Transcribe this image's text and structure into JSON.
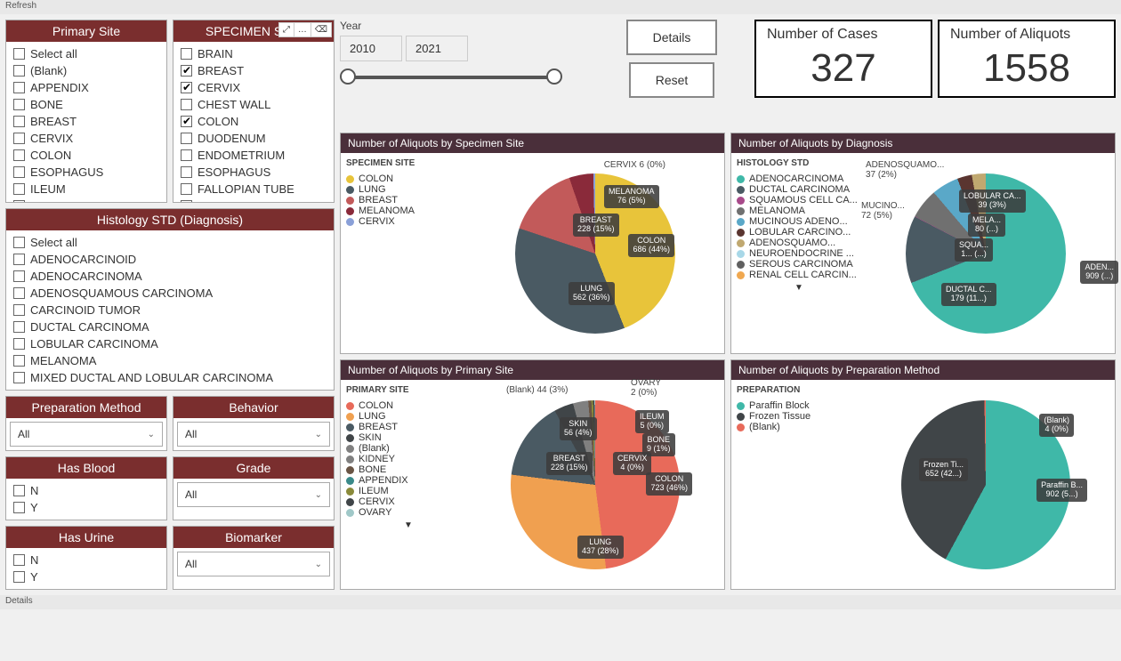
{
  "topbar": {
    "refresh": "Refresh"
  },
  "bottombar": {
    "details": "Details"
  },
  "filters": {
    "primary_site": {
      "title": "Primary Site",
      "items": [
        {
          "label": "Select all",
          "checked": false
        },
        {
          "label": "(Blank)",
          "checked": false
        },
        {
          "label": "APPENDIX",
          "checked": false
        },
        {
          "label": "BONE",
          "checked": false
        },
        {
          "label": "BREAST",
          "checked": false
        },
        {
          "label": "CERVIX",
          "checked": false
        },
        {
          "label": "COLON",
          "checked": false
        },
        {
          "label": "ESOPHAGUS",
          "checked": false
        },
        {
          "label": "ILEUM",
          "checked": false
        },
        {
          "label": "KIDNEY",
          "checked": false
        }
      ]
    },
    "specimen_site": {
      "title": "SPECIMEN SITE",
      "items": [
        {
          "label": "BRAIN",
          "checked": false
        },
        {
          "label": "BREAST",
          "checked": true
        },
        {
          "label": "CERVIX",
          "checked": true
        },
        {
          "label": "CHEST WALL",
          "checked": false
        },
        {
          "label": "COLON",
          "checked": true
        },
        {
          "label": "DUODENUM",
          "checked": false
        },
        {
          "label": "ENDOMETRIUM",
          "checked": false
        },
        {
          "label": "ESOPHAGUS",
          "checked": false
        },
        {
          "label": "FALLOPIAN TUBE",
          "checked": false
        },
        {
          "label": "FAT",
          "checked": false
        }
      ]
    },
    "histology": {
      "title": "Histology STD (Diagnosis)",
      "items": [
        {
          "label": "Select all",
          "checked": false
        },
        {
          "label": "ADENOCARCINOID",
          "checked": false
        },
        {
          "label": "ADENOCARCINOMA",
          "checked": false
        },
        {
          "label": "ADENOSQUAMOUS CARCINOMA",
          "checked": false
        },
        {
          "label": "CARCINOID TUMOR",
          "checked": false
        },
        {
          "label": "DUCTAL CARCINOMA",
          "checked": false
        },
        {
          "label": "LOBULAR CARCINOMA",
          "checked": false
        },
        {
          "label": "MELANOMA",
          "checked": false
        },
        {
          "label": "MIXED DUCTAL AND LOBULAR CARCINOMA",
          "checked": false
        }
      ]
    },
    "prep_method": {
      "title": "Preparation Method",
      "value": "All"
    },
    "behavior": {
      "title": "Behavior",
      "value": "All"
    },
    "has_blood": {
      "title": "Has Blood",
      "items": [
        {
          "label": "N",
          "checked": false
        },
        {
          "label": "Y",
          "checked": false
        }
      ]
    },
    "grade": {
      "title": "Grade",
      "value": "All"
    },
    "has_urine": {
      "title": "Has Urine",
      "items": [
        {
          "label": "N",
          "checked": false
        },
        {
          "label": "Y",
          "checked": false
        }
      ]
    },
    "biomarker": {
      "title": "Biomarker",
      "value": "All"
    }
  },
  "year": {
    "label": "Year",
    "from": "2010",
    "to": "2021"
  },
  "buttons": {
    "details": "Details",
    "reset": "Reset"
  },
  "stats": {
    "cases": {
      "title": "Number of Cases",
      "value": "327"
    },
    "aliquots": {
      "title": "Number of Aliquots",
      "value": "1558"
    }
  },
  "chart_data": [
    {
      "id": "specimen",
      "title": "Number of Aliquots by Specimen Site",
      "legend_title": "SPECIMEN SITE",
      "type": "pie",
      "series": [
        {
          "name": "COLON",
          "value": 686,
          "pct": "44%",
          "color": "#e8c43a"
        },
        {
          "name": "LUNG",
          "value": 562,
          "pct": "36%",
          "color": "#4a5a63"
        },
        {
          "name": "BREAST",
          "value": 228,
          "pct": "15%",
          "color": "#c25a5a"
        },
        {
          "name": "MELANOMA",
          "value": 76,
          "pct": "5%",
          "color": "#8a2a3a"
        },
        {
          "name": "CERVIX",
          "value": 6,
          "pct": "0%",
          "color": "#8aa0d8"
        }
      ]
    },
    {
      "id": "diagnosis",
      "title": "Number of Aliquots by Diagnosis",
      "legend_title": "HISTOLOGY STD",
      "type": "pie",
      "series": [
        {
          "name": "ADENOCARCINOMA",
          "short": "ADEN...",
          "value": 909,
          "pct": "(...)",
          "color": "#3fb8a8"
        },
        {
          "name": "DUCTAL CARCINOMA",
          "short": "DUCTAL C...",
          "value": 179,
          "pct": "11...",
          "color": "#4a5a63"
        },
        {
          "name": "SQUAMOUS CELL CA...",
          "short": "SQUA...",
          "value": 1,
          "pct": "(...)",
          "color": "#a84a8a"
        },
        {
          "name": "MELANOMA",
          "short": "MELA...",
          "value": 80,
          "pct": "(...)",
          "color": "#707070"
        },
        {
          "name": "MUCINOUS ADENO...",
          "short": "MUCINO...",
          "value": 72,
          "pct": "5%",
          "color": "#5aa8c8"
        },
        {
          "name": "LOBULAR CARCINO...",
          "short": "LOBULAR CA...",
          "value": 39,
          "pct": "3%",
          "color": "#5a3530"
        },
        {
          "name": "ADENOSQUAMO...",
          "short": "ADENOSQUAMO...",
          "value": 37,
          "pct": "2%",
          "color": "#c0a870"
        },
        {
          "name": "NEUROENDOCRINE ...",
          "value": 0,
          "color": "#a8d8e8"
        },
        {
          "name": "SEROUS CARCINOMA",
          "value": 0,
          "color": "#606060"
        },
        {
          "name": "RENAL CELL CARCIN...",
          "value": 0,
          "color": "#f0a850"
        }
      ]
    },
    {
      "id": "primary",
      "title": "Number of Aliquots by Primary Site",
      "legend_title": "PRIMARY SITE",
      "type": "pie",
      "series": [
        {
          "name": "COLON",
          "value": 723,
          "pct": "46%",
          "color": "#e86a5a"
        },
        {
          "name": "LUNG",
          "value": 437,
          "pct": "28%",
          "color": "#f0a050"
        },
        {
          "name": "BREAST",
          "value": 228,
          "pct": "15%",
          "color": "#4a5a63"
        },
        {
          "name": "SKIN",
          "value": 56,
          "pct": "4%",
          "color": "#404548"
        },
        {
          "name": "(Blank)",
          "value": 44,
          "pct": "3%",
          "color": "#808080"
        },
        {
          "name": "KIDNEY",
          "value": 0,
          "color": "#808080"
        },
        {
          "name": "BONE",
          "value": 9,
          "pct": "1%",
          "color": "#6a5545"
        },
        {
          "name": "APPENDIX",
          "value": 0,
          "color": "#3a8a8a"
        },
        {
          "name": "ILEUM",
          "value": 5,
          "pct": "0%",
          "color": "#8a8a3a"
        },
        {
          "name": "CERVIX",
          "value": 4,
          "pct": "0%",
          "color": "#404548"
        },
        {
          "name": "OVARY",
          "value": 2,
          "pct": "0%",
          "color": "#a0c8c8"
        }
      ]
    },
    {
      "id": "prep",
      "title": "Number of Aliquots by Preparation Method",
      "legend_title": "PREPARATION",
      "type": "pie",
      "series": [
        {
          "name": "Paraffin Block",
          "short": "Paraffin B...",
          "value": 902,
          "pct": "5...",
          "color": "#3fb8a8"
        },
        {
          "name": "Frozen Tissue",
          "short": "Frozen Ti...",
          "value": 652,
          "pct": "42...",
          "color": "#404548"
        },
        {
          "name": "(Blank)",
          "short": "(Blank)",
          "value": 4,
          "pct": "0%",
          "color": "#e86a5a"
        }
      ]
    }
  ]
}
